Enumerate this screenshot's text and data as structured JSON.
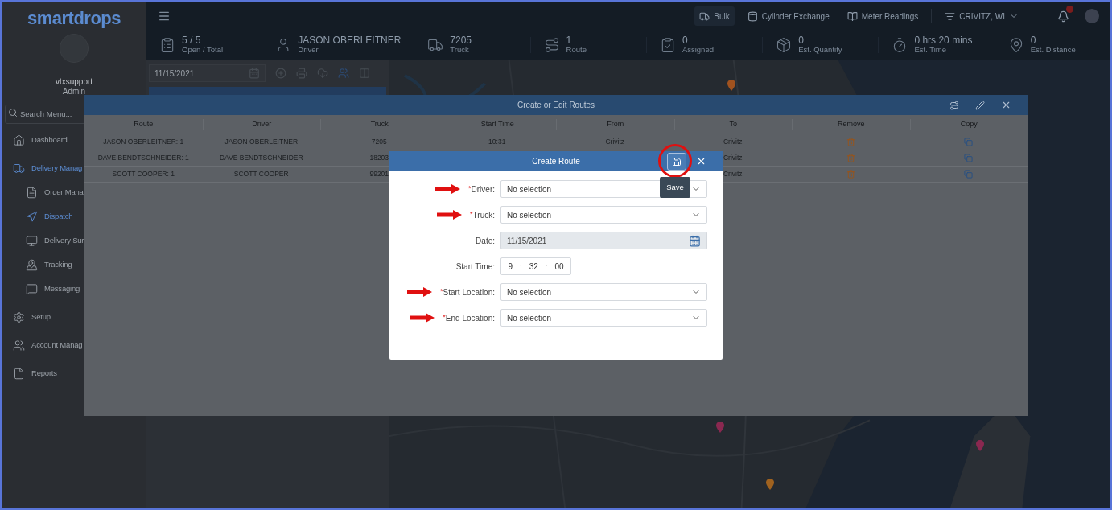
{
  "sidebar": {
    "logo": "smartdrops",
    "user": {
      "name": "vtxsupport",
      "role": "Admin"
    },
    "search": {
      "placeholder": "Search Menu..."
    },
    "items": [
      {
        "label": "Dashboard",
        "selected": false
      },
      {
        "label": "Delivery Manag",
        "selected": true,
        "children": [
          {
            "label": "Order Mana",
            "selected": false
          },
          {
            "label": "Dispatch",
            "selected": true
          },
          {
            "label": "Delivery Sur",
            "selected": false
          },
          {
            "label": "Tracking",
            "selected": false
          },
          {
            "label": "Messaging",
            "selected": false
          }
        ]
      },
      {
        "label": "Setup",
        "selected": false
      },
      {
        "label": "Account Manag",
        "selected": false
      },
      {
        "label": "Reports",
        "selected": false
      }
    ]
  },
  "topbar": {
    "nav": [
      {
        "label": "Bulk",
        "selected": true
      },
      {
        "label": "Cylinder Exchange",
        "selected": false
      },
      {
        "label": "Meter Readings",
        "selected": false
      }
    ],
    "location": "CRIVITZ, WI",
    "notification_badge": true
  },
  "stats": [
    {
      "value": "5 / 5",
      "label": "Open / Total"
    },
    {
      "value": "JASON OBERLEITNER",
      "label": "Driver"
    },
    {
      "value": "7205",
      "label": "Truck"
    },
    {
      "value": "1",
      "label": "Route"
    },
    {
      "value": "0",
      "label": "Assigned"
    },
    {
      "value": "0",
      "label": "Est. Quantity"
    },
    {
      "value": "0 hrs 20 mins",
      "label": "Est. Time"
    },
    {
      "value": "0",
      "label": "Est. Distance"
    }
  ],
  "toolbar": {
    "date": "11/15/2021"
  },
  "routes_dialog": {
    "title": "Create or Edit Routes",
    "columns": [
      "Route",
      "Driver",
      "Truck",
      "Start Time",
      "From",
      "To",
      "Remove",
      "Copy"
    ],
    "rows": [
      {
        "route": "JASON OBERLEITNER: 1",
        "driver": "JASON OBERLEITNER",
        "truck": "7205",
        "start_time": "10:31",
        "from": "Crivitz",
        "to": "Crivitz"
      },
      {
        "route": "DAVE BENDTSCHNEIDER: 1",
        "driver": "DAVE BENDTSCHNEIDER",
        "truck": "18203",
        "to": "Crivitz"
      },
      {
        "route": "SCOTT COOPER: 1",
        "driver": "SCOTT COOPER",
        "truck": "99201",
        "to": "Crivitz"
      }
    ]
  },
  "create_route": {
    "title": "Create Route",
    "save_tooltip": "Save",
    "save_highlighted": true,
    "required_mark": "*",
    "fields": [
      {
        "kind": "select",
        "label": "Driver:",
        "required": true,
        "pointed": true,
        "disabled": false,
        "value": "No selection"
      },
      {
        "kind": "select",
        "label": "Truck:",
        "required": true,
        "pointed": true,
        "disabled": false,
        "value": "No selection"
      },
      {
        "kind": "date",
        "label": "Date:",
        "required": false,
        "pointed": false,
        "disabled": true,
        "value": "11/15/2021"
      },
      {
        "kind": "time",
        "label": "Start Time:",
        "required": false,
        "pointed": false,
        "disabled": false,
        "parts": [
          "9",
          "32",
          "00"
        ],
        "separator": ":"
      },
      {
        "kind": "select",
        "label": "Start Location:",
        "required": true,
        "pointed": true,
        "disabled": false,
        "value": "No selection"
      },
      {
        "kind": "select",
        "label": "End Location:",
        "required": true,
        "pointed": true,
        "disabled": false,
        "value": "No selection"
      }
    ]
  }
}
